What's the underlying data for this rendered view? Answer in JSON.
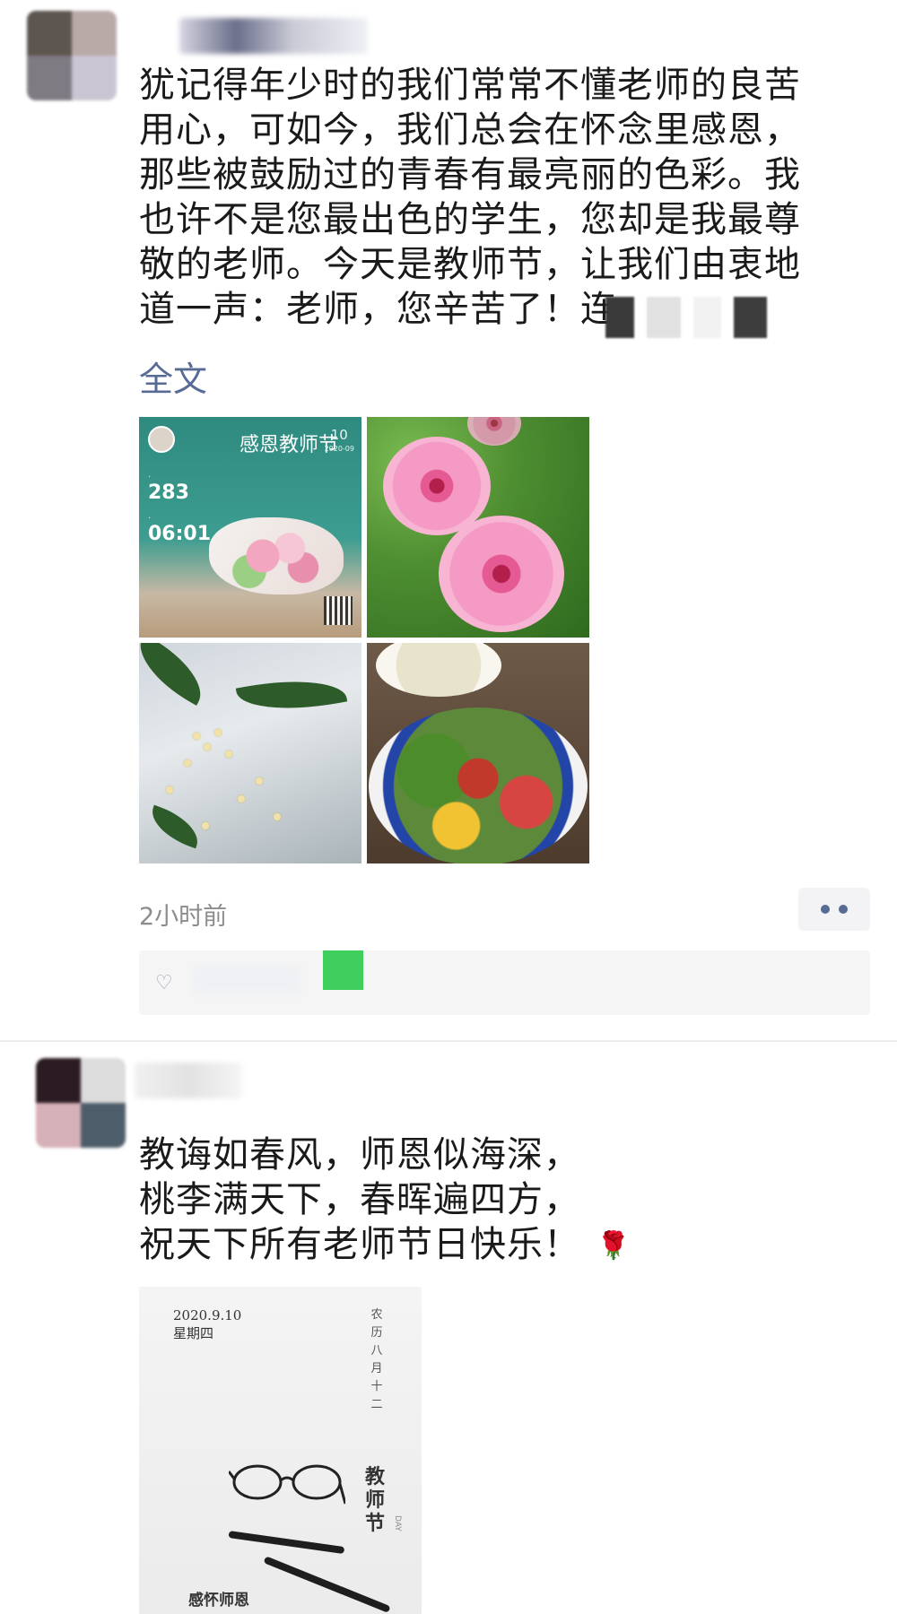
{
  "post1": {
    "text_lines": [
      "犹记得年少时的我们常常不懂老师的良苦",
      "用心，可如今，我们总会在怀念里感恩，",
      "那些被鼓励过的青春有最亮丽的色彩。我",
      "也许不是您最出色的学生，您却是我最尊",
      "敬的老师。今天是教师节，让我们由衷地",
      "道一声：老师，您辛苦了！连"
    ],
    "full_text_link": "全文",
    "images": [
      {
        "title": "感恩教师节",
        "date_big": "10",
        "date_small": "2020-09",
        "num1": "283",
        "num2": "06:01"
      },
      {
        "icon": "hibiscus-photo"
      },
      {
        "icon": "osmanthus-photo"
      },
      {
        "icon": "food-bowl-photo"
      }
    ],
    "time": "2小时前"
  },
  "post2": {
    "text_lines": [
      "教诲如春风，师恩似海深，",
      "桃李满天下，春晖遍四方，",
      "祝天下所有老师节日快乐！"
    ],
    "emoji": "🌹",
    "photo": {
      "date": "2020.9.10",
      "weekday": "星期四",
      "lunar": "农历八月十二",
      "title": "教师节",
      "day": "DAY",
      "caption": "感怀师恩"
    }
  },
  "colors": {
    "link": "#576b95",
    "time": "#8c8c8c",
    "green_badge": "#3fcf5d"
  }
}
